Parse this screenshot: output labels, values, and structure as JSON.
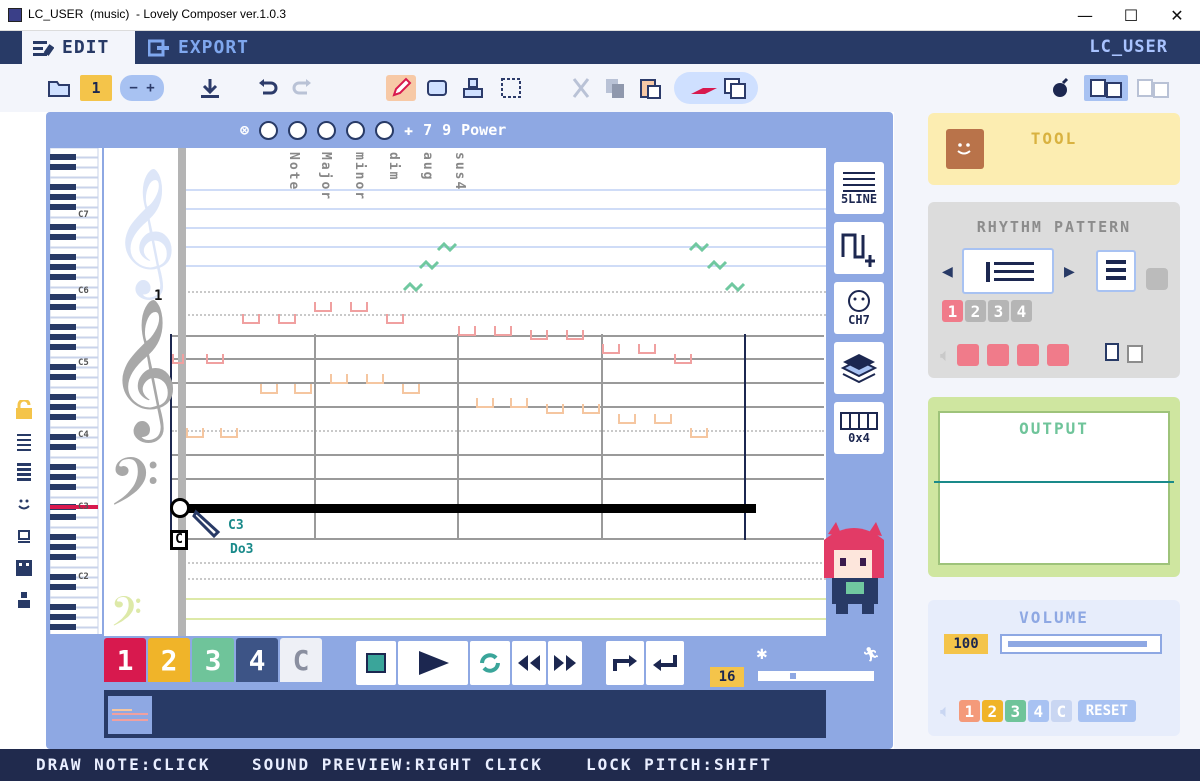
{
  "window": {
    "title": "LC_USER  (music)  - Lovely Composer ver.1.0.3",
    "min_glyph": "—",
    "max_glyph": "☐",
    "close_glyph": "✕"
  },
  "menu": {
    "edit_label": "EDIT",
    "export_label": "EXPORT",
    "user_label": "LC_USER"
  },
  "toolbar": {
    "page_number": "1"
  },
  "chord_bar": {
    "num1": "7",
    "num2": "9",
    "power_label": "Power"
  },
  "staff": {
    "chord_names": [
      "Note",
      "Major",
      "minor",
      "dim",
      "aug",
      "sus4"
    ],
    "measure_number": "1",
    "octave_labels": [
      "C7",
      "C6",
      "C5",
      "C4",
      "C3",
      "C2"
    ],
    "pitch_name": "C3",
    "solfege_name": "Do3"
  },
  "tool_tabs": [
    "5LINE",
    "",
    "CH7",
    "",
    "0x4"
  ],
  "tracks": {
    "labels": [
      "1",
      "2",
      "3",
      "4",
      "C"
    ],
    "colors": [
      "#d8194e",
      "#f0b429",
      "#6fc49a",
      "#3d5486",
      "#eef0f6"
    ]
  },
  "tempo": {
    "value": "16"
  },
  "right_panel": {
    "tool_title": "TOOL",
    "rhythm_title": "RHYTHM PATTERN",
    "rhythm_slots": [
      "1",
      "2",
      "3",
      "4"
    ],
    "output_title": "OUTPUT",
    "volume_title": "VOLUME",
    "volume_value": "100",
    "volume_level": 0.95,
    "volume_tracks": [
      "1",
      "2",
      "3",
      "4",
      "C"
    ],
    "reset_label": "RESET"
  },
  "status": {
    "draw": "DRAW NOTE:CLICK",
    "preview": "SOUND PREVIEW:RIGHT CLICK",
    "lock": "LOCK PITCH:SHIFT"
  },
  "colors": {
    "navy": "#283a66",
    "accent_red": "#d8194e",
    "note_pink": "#f0a0a0",
    "note_peach": "#f5c6a0",
    "chord_green": "#70c8a0",
    "output_line": "#1a8a8a"
  }
}
